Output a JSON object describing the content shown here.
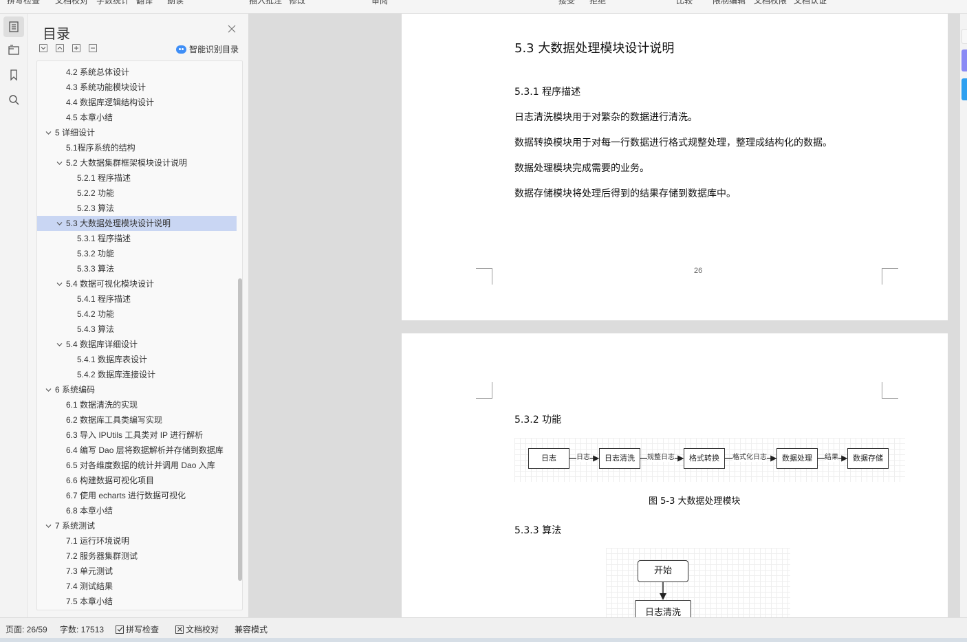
{
  "toolbar": {
    "items": [
      "拼写检查",
      "文档校对",
      "字数统计",
      "翻译",
      "朗读",
      "插入批注",
      "修改",
      "审阅",
      "接受",
      "拒绝",
      "比较",
      "限制编辑",
      "文档权限",
      "文档认证"
    ]
  },
  "rail": {
    "buttons": [
      "toc-icon",
      "navigation-icon",
      "bookmark-icon",
      "search-icon"
    ]
  },
  "toc_panel": {
    "title": "目录",
    "smart_label": "智能识别目录",
    "items": [
      {
        "label": "4.2  系统总体设计",
        "level": 2,
        "expand": false
      },
      {
        "label": "4.3  系统功能模块设计",
        "level": 2,
        "expand": false
      },
      {
        "label": "4.4  数据库逻辑结构设计",
        "level": 2,
        "expand": false
      },
      {
        "label": "4.5  本章小结",
        "level": 2,
        "expand": false
      },
      {
        "label": "5    详细设计",
        "level": 1,
        "expand": true
      },
      {
        "label": "5.1程序系统的结构",
        "level": 2,
        "expand": false
      },
      {
        "label": "5.2    大数据集群框架模块设计说明",
        "level": 2,
        "expand": true
      },
      {
        "label": "5.2.1  程序描述",
        "level": 3,
        "expand": false
      },
      {
        "label": "5.2.2  功能",
        "level": 3,
        "expand": false
      },
      {
        "label": "5.2.3  算法",
        "level": 3,
        "expand": false
      },
      {
        "label": "5.3    大数据处理模块设计说明",
        "level": 2,
        "expand": true,
        "selected": true
      },
      {
        "label": "5.3.1  程序描述",
        "level": 3,
        "expand": false
      },
      {
        "label": "5.3.2  功能",
        "level": 3,
        "expand": false
      },
      {
        "label": "5.3.3  算法",
        "level": 3,
        "expand": false
      },
      {
        "label": "5.4    数据可视化模块设计",
        "level": 2,
        "expand": true
      },
      {
        "label": "5.4.1  程序描述",
        "level": 3,
        "expand": false
      },
      {
        "label": "5.4.2  功能",
        "level": 3,
        "expand": false
      },
      {
        "label": "5.4.3  算法",
        "level": 3,
        "expand": false
      },
      {
        "label": "5.4    数据库详细设计",
        "level": 2,
        "expand": true
      },
      {
        "label": "5.4.1  数据库表设计",
        "level": 3,
        "expand": false
      },
      {
        "label": "5.4.2  数据库连接设计",
        "level": 3,
        "expand": false
      },
      {
        "label": "6    系统编码",
        "level": 1,
        "expand": true
      },
      {
        "label": "6.1  数据清洗的实现",
        "level": 2,
        "expand": false
      },
      {
        "label": "6.2  数据库工具类编写实现",
        "level": 2,
        "expand": false
      },
      {
        "label": "6.3 导入 IPUtils 工具类对 IP 进行解析",
        "level": 2,
        "expand": false
      },
      {
        "label": "6.4 编写 Dao 层将数据解析并存储到数据库",
        "level": 2,
        "expand": false
      },
      {
        "label": "6.5  对各维度数据的统计并调用 Dao 入库",
        "level": 2,
        "expand": false
      },
      {
        "label": "6.6  构建数据可视化项目",
        "level": 2,
        "expand": false
      },
      {
        "label": "6.7  使用 echarts 进行数据可视化",
        "level": 2,
        "expand": false
      },
      {
        "label": "6.8  本章小结",
        "level": 2,
        "expand": false
      },
      {
        "label": "7    系统测试",
        "level": 1,
        "expand": true
      },
      {
        "label": "7.1  运行环境说明",
        "level": 2,
        "expand": false
      },
      {
        "label": "7.2  服务器集群测试",
        "level": 2,
        "expand": false
      },
      {
        "label": "7.3  单元测试",
        "level": 2,
        "expand": false
      },
      {
        "label": "7.4  测试结果",
        "level": 2,
        "expand": false
      },
      {
        "label": "7.5  本章小结",
        "level": 2,
        "expand": false
      }
    ]
  },
  "page1": {
    "heading": "5.3    大数据处理模块设计说明",
    "subheading": "5.3.1  程序描述",
    "paragraphs": [
      "日志清洗模块用于对繁杂的数据进行清洗。",
      "数据转换模块用于对每一行数据进行格式规整处理，整理成结构化的数据。",
      "数据处理模块完成需要的业务。",
      "数据存储模块将处理后得到的结果存储到数据库中。"
    ],
    "page_number": "26"
  },
  "page2": {
    "subheading_func": "5.3.2  功能",
    "flow": {
      "boxes": [
        "日志",
        "日志清洗",
        "格式转换",
        "数据处理",
        "数据存储"
      ],
      "edge_labels": [
        "日志",
        "规整日志",
        "格式化日志",
        "结果"
      ]
    },
    "figure_caption": "图 5-3  大数据处理模块",
    "subheading_algo": "5.3.3  算法",
    "algo": {
      "start": "开始",
      "step1": "日志清洗"
    }
  },
  "statusbar": {
    "page": "页面: 26/59",
    "words": "字数: 17513",
    "spell": "拼写检查",
    "proof": "文档校对",
    "compat": "兼容模式"
  },
  "colors": {
    "selection": "#c9d6f3",
    "accent": "#3e8ef7",
    "edge_purple": "#8a8af5",
    "edge_blue": "#2ea0f0"
  }
}
